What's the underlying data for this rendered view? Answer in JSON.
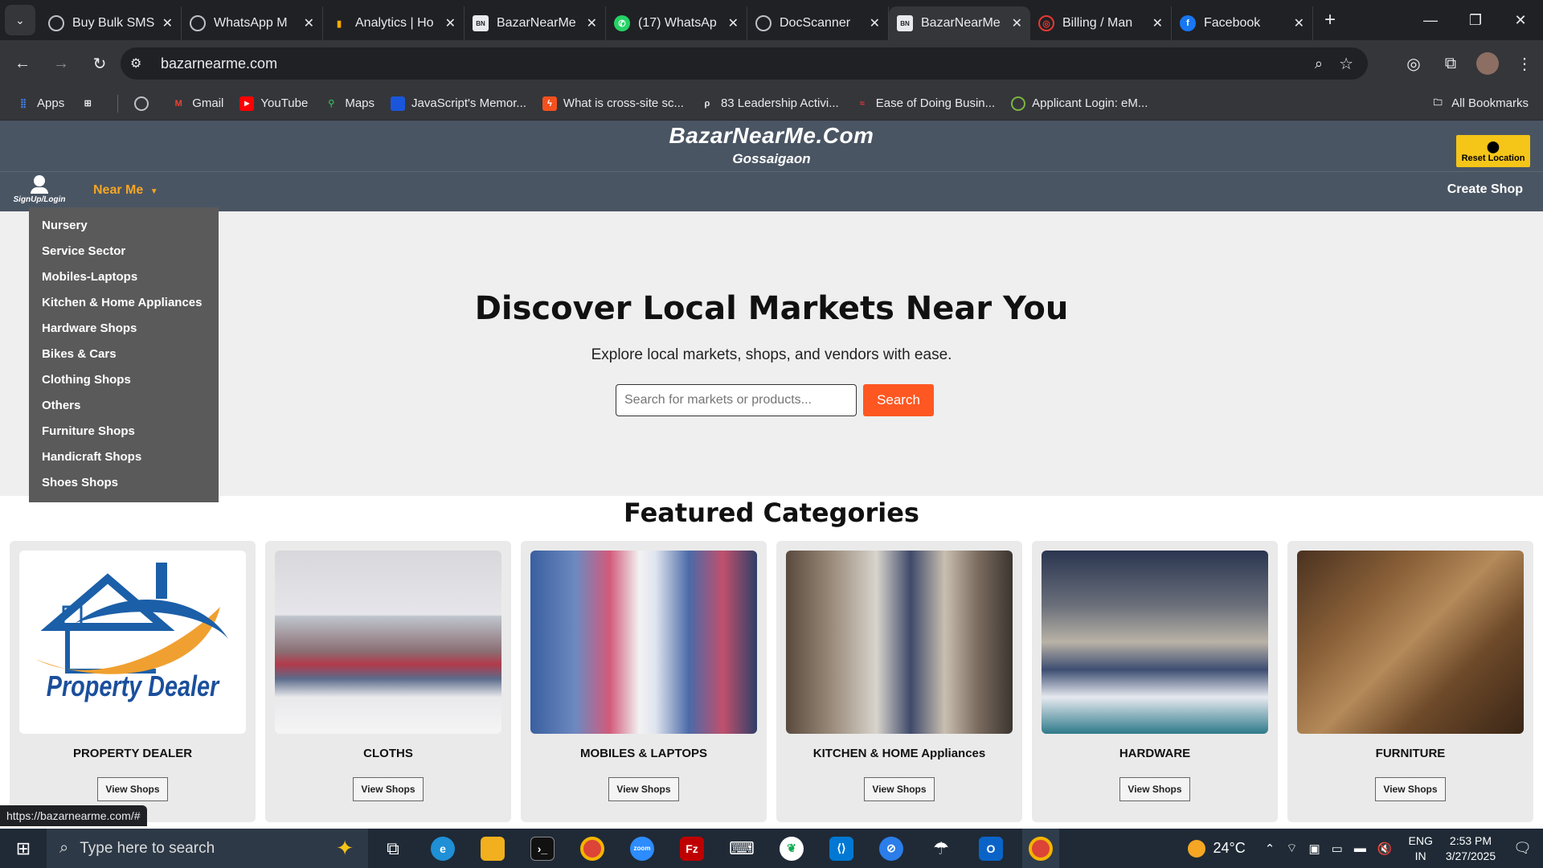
{
  "browser": {
    "tabs": [
      {
        "title": "Buy Bulk SMS",
        "favicon": "globe-icon"
      },
      {
        "title": "WhatsApp M",
        "favicon": "globe-icon"
      },
      {
        "title": "Analytics | Ho",
        "favicon": "analytics-icon"
      },
      {
        "title": "BazarNearMe",
        "favicon": "bazar-icon"
      },
      {
        "title": "(17) WhatsAp",
        "favicon": "whatsapp-icon"
      },
      {
        "title": "DocScanner",
        "favicon": "globe-icon"
      },
      {
        "title": "BazarNearMe",
        "favicon": "bazar-icon",
        "active": true
      },
      {
        "title": "Billing / Man",
        "favicon": "billing-icon"
      },
      {
        "title": "Facebook",
        "favicon": "facebook-icon"
      }
    ],
    "url": "bazarnearme.com",
    "bookmarks": [
      {
        "label": "Apps",
        "icon": "apps-icon"
      },
      {
        "label": "Gmail",
        "icon": "gmail-icon"
      },
      {
        "label": "YouTube",
        "icon": "youtube-icon"
      },
      {
        "label": "Maps",
        "icon": "maps-icon"
      },
      {
        "label": "JavaScript's Memor...",
        "icon": "bookmark-icon"
      },
      {
        "label": "What is cross-site sc...",
        "icon": "bookmark-icon"
      },
      {
        "label": "83 Leadership Activi...",
        "icon": "bookmark-icon"
      },
      {
        "label": "Ease of Doing Busin...",
        "icon": "bookmark-icon"
      },
      {
        "label": "Applicant Login: eM...",
        "icon": "bookmark-icon"
      }
    ],
    "all_bookmarks": "All Bookmarks",
    "status_url": "https://bazarnearme.com/#"
  },
  "site": {
    "brand": "BazarNearMe.Com",
    "location": "Gossaigaon",
    "reset_location": "Reset Location",
    "login_label": "SignUp/Login",
    "near_me": "Near Me",
    "create_shop": "Create Shop",
    "dropdown": [
      "Nursery",
      "Service Sector",
      "Mobiles-Laptops",
      "Kitchen & Home Appliances",
      "Hardware Shops",
      "Bikes & Cars",
      "Clothing Shops",
      "Others",
      "Furniture Shops",
      "Handicraft Shops",
      "Shoes Shops"
    ],
    "hero_title": "Discover Local Markets Near You",
    "hero_subtitle": "Explore local markets, shops, and vendors with ease.",
    "search_placeholder": "Search for markets or products...",
    "search_button": "Search",
    "featured_title": "Featured Categories",
    "categories": [
      {
        "label": "PROPERTY DEALER",
        "image_text": "Property Dealer",
        "button": "View Shops"
      },
      {
        "label": "CLOTHS",
        "button": "View Shops"
      },
      {
        "label": "MOBILES & LAPTOPS",
        "button": "View Shops"
      },
      {
        "label": "KITCHEN & HOME Appliances",
        "button": "View Shops"
      },
      {
        "label": "HARDWARE",
        "button": "View Shops"
      },
      {
        "label": "FURNITURE",
        "button": "View Shops"
      }
    ]
  },
  "taskbar": {
    "search_placeholder": "Type here to search",
    "weather": "24°C",
    "lang_line1": "ENG",
    "lang_line2": "IN",
    "time": "2:53 PM",
    "date": "3/27/2025"
  },
  "colors": {
    "header_bg": "#4a5563",
    "accent_orange": "#ff5722",
    "nearme_color": "#f5a623",
    "reset_bg": "#f5c518",
    "dropdown_bg": "#5a5a5a"
  }
}
